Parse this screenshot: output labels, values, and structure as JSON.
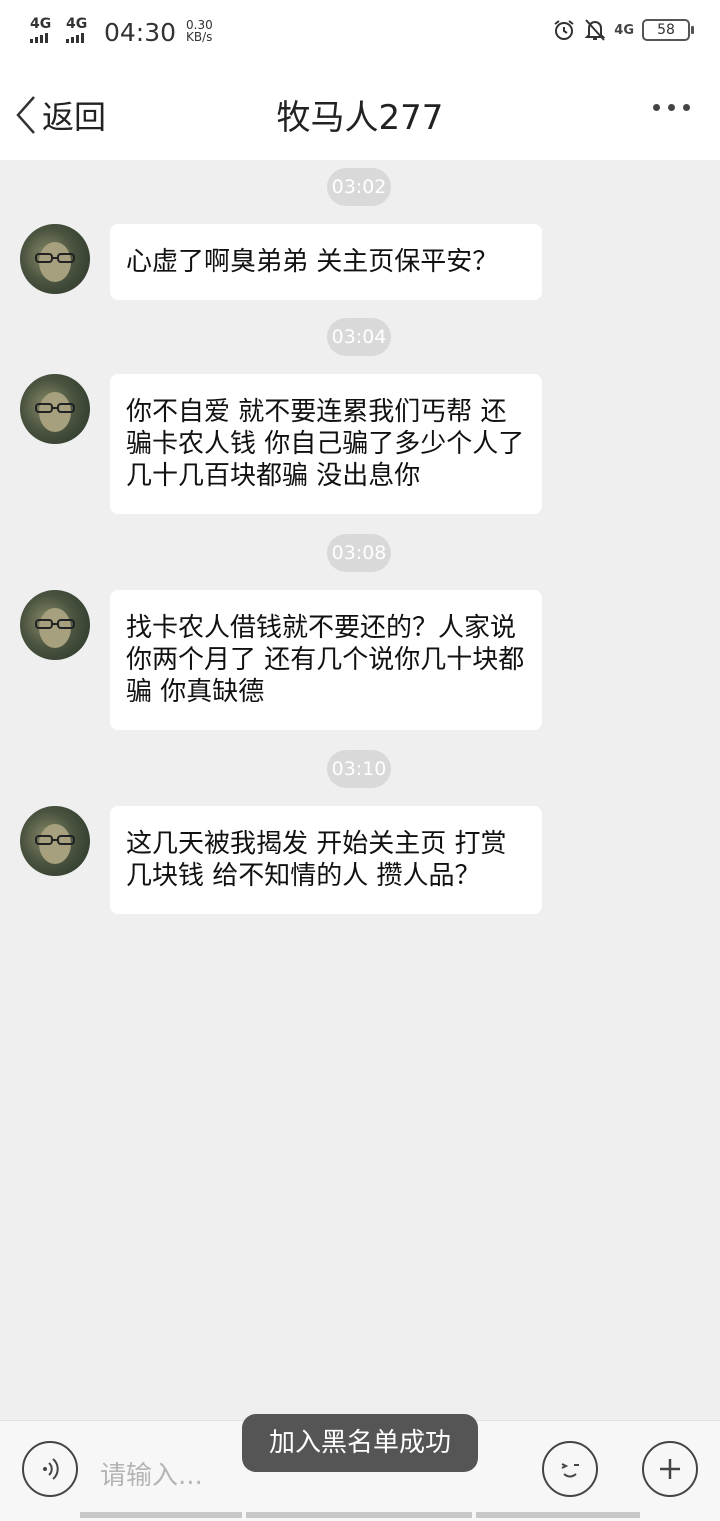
{
  "status_bar": {
    "signal1": "4G",
    "signal2": "4G",
    "time": "04:30",
    "net_speed_value": "0.30",
    "net_speed_unit": "KB/s",
    "network_right": "4G",
    "battery": "58"
  },
  "header": {
    "back_label": "返回",
    "title": "牧马人277"
  },
  "messages": [
    {
      "time": "03:02",
      "text": "心虚了啊臭弟弟 关主页保平安？"
    },
    {
      "time": "03:04",
      "text": "你不自爱 就不要连累我们丐帮 还骗卡农人钱 你自己骗了多少个人了 几十几百块都骗 没出息你"
    },
    {
      "time": "03:08",
      "text": "找卡农人借钱就不要还的？人家说你两个月了 还有几个说你几十块都骗 你真缺德"
    },
    {
      "time": "03:10",
      "text": "这几天被我揭发 开始关主页 打赏几块钱 给不知情的人 攒人品？"
    }
  ],
  "input": {
    "placeholder": "请输入..."
  },
  "toast": "加入黑名单成功",
  "icons": {
    "back": "chevron-left-icon",
    "more": "more-dots-icon",
    "voice": "voice-icon",
    "emoji": "emoji-icon",
    "plus": "plus-icon",
    "alarm": "alarm-icon",
    "mute": "bell-off-icon"
  }
}
